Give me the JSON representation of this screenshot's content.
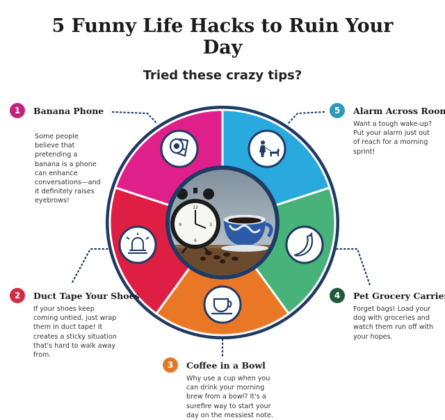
{
  "title": "5 Funny Life Hacks to Ruin Your Day",
  "subtitle": "Tried these crazy tips?",
  "colors": {
    "magenta": "#e0208a",
    "blue": "#29a9de",
    "green": "#47b27a",
    "orange": "#ea7726",
    "red": "#de1f43",
    "navy": "#1f3a63"
  },
  "items": [
    {
      "number": "1",
      "title": "Banana Phone",
      "description": "Some people believe that pretending a banana is a phone can enhance conversations—and it definitely raises eyebrows!",
      "icon": "toilet-paper-icon",
      "badge_color": "#c0237d"
    },
    {
      "number": "2",
      "title": "Duct Tape Your Shoes",
      "description": "If your shoes keep coming untied, just wrap them in duct tape! It creates a sticky situation that's hard to walk away from.",
      "icon": "alarm-bell-icon",
      "badge_color": "#d42a45"
    },
    {
      "number": "3",
      "title": "Coffee in a Bowl",
      "description": "Why use a cup when you can drink your morning brew from a bowl? It's a surefire way to start your day on the messiest note.",
      "icon": "coffee-cup-icon",
      "badge_color": "#e07a2a"
    },
    {
      "number": "4",
      "title": "Pet Grocery Carrier",
      "description": "Forget bags! Load your dog with groceries and watch them run off with your hopes.",
      "icon": "banana-icon",
      "badge_color": "#1f5a3a"
    },
    {
      "number": "5",
      "title": "Alarm Across Room",
      "description": "Want a tough wake-up? Put your alarm just out of reach for a morning sprint!",
      "icon": "person-dog-icon",
      "badge_color": "#2d9bb8"
    }
  ]
}
